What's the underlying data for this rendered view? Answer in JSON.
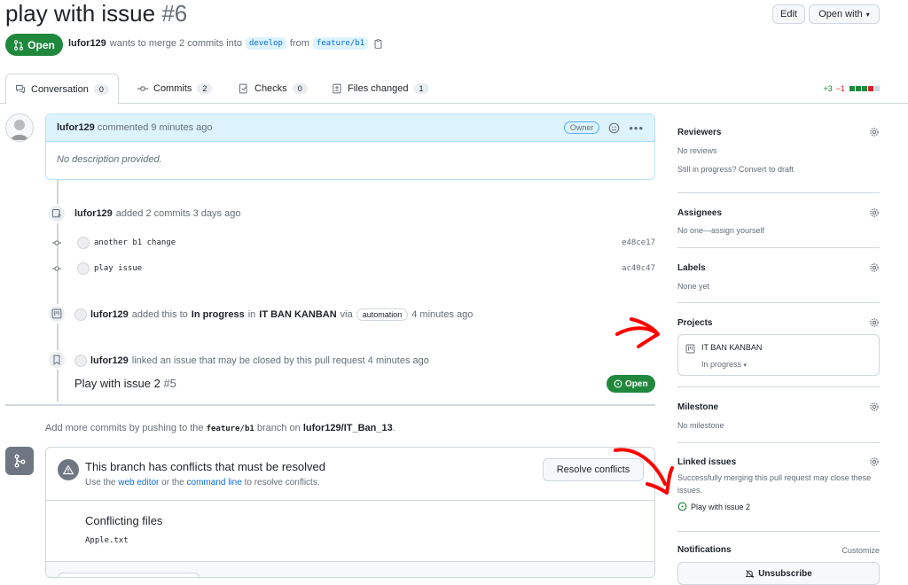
{
  "header": {
    "title": "play with issue",
    "number": "#6",
    "edit_label": "Edit",
    "open_with_label": "Open with"
  },
  "pr_meta": {
    "state": "Open",
    "author": "lufor129",
    "action_text": "wants to merge 2 commits into",
    "base_branch": "develop",
    "from_text": "from",
    "head_branch": "feature/b1"
  },
  "tabs": [
    {
      "label": "Conversation",
      "count": "0"
    },
    {
      "label": "Commits",
      "count": "2"
    },
    {
      "label": "Checks",
      "count": "0"
    },
    {
      "label": "Files changed",
      "count": "1"
    }
  ],
  "diffstat": {
    "added": "+3",
    "removed": "−1"
  },
  "comment": {
    "author": "lufor129",
    "meta": "commented 9 minutes ago",
    "role": "Owner",
    "body": "No description provided."
  },
  "timeline": {
    "commits_event": {
      "actor": "lufor129",
      "text": "added 2 commits 3 days ago"
    },
    "commits": [
      {
        "message": "another b1 change",
        "sha": "e48ce17"
      },
      {
        "message": "play issue",
        "sha": "ac40c47"
      }
    ],
    "project_event": {
      "actor": "lufor129",
      "text1": "added this to",
      "status": "In progress",
      "text2": "in",
      "project": "IT BAN KANBAN",
      "via": "via",
      "app": "automation",
      "time": "4 minutes ago"
    },
    "link_event": {
      "actor": "lufor129",
      "text": "linked an issue that may be closed by this pull request 4 minutes ago"
    },
    "linked_issue": {
      "title": "Play with issue 2",
      "number": "#5",
      "state": "Open"
    }
  },
  "push_hint": {
    "prefix": "Add more commits by pushing to the",
    "branch": "feature/b1",
    "middle": "branch on",
    "repo": "lufor129/IT_Ban_13",
    "suffix": "."
  },
  "merge_box": {
    "title": "This branch has conflicts that must be resolved",
    "sub_use": "Use the",
    "sub_web_editor": "web editor",
    "sub_or": "or the",
    "sub_command_line": "command line",
    "sub_tail": "to resolve conflicts.",
    "resolve_label": "Resolve conflicts",
    "conflicting_heading": "Conflicting files",
    "files": [
      "Apple.txt"
    ]
  },
  "sidebar": {
    "reviewers": {
      "heading": "Reviewers",
      "text": "No reviews",
      "extra": "Still in progress? Convert to draft"
    },
    "assignees": {
      "heading": "Assignees",
      "text": "No one—assign yourself"
    },
    "labels": {
      "heading": "Labels",
      "text": "None yet"
    },
    "projects": {
      "heading": "Projects",
      "name": "IT BAN KANBAN",
      "status": "In progress"
    },
    "milestone": {
      "heading": "Milestone",
      "text": "No milestone"
    },
    "linked_issues": {
      "heading": "Linked issues",
      "text": "Successfully merging this pull request may close these issues.",
      "issue": "Play with issue 2"
    },
    "notifications": {
      "heading": "Notifications",
      "customize": "Customize",
      "unsubscribe": "Unsubscribe"
    }
  },
  "colors": {
    "accent": "#0969da",
    "success": "#1f883d",
    "annotation": "#ff0000"
  }
}
